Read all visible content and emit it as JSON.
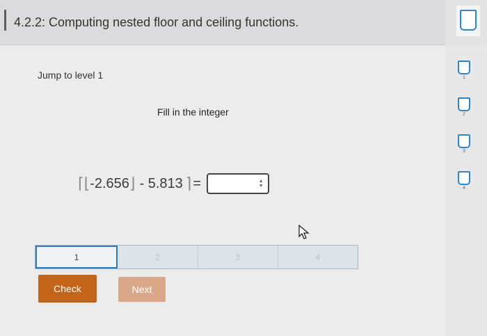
{
  "header": {
    "title": "4.2.2: Computing nested floor and ceiling functions."
  },
  "main": {
    "jump_label": "Jump to level 1",
    "instruction": "Fill in the integer",
    "equation": {
      "ceil_open": "⌈",
      "floor_open": "⌊",
      "value_a": "-2.656",
      "floor_close": "⌋",
      "operator_text": "- 5.813",
      "ceil_close": "⌉",
      "equals": "=",
      "answer_value": ""
    }
  },
  "levels": [
    {
      "label": "1",
      "active": true
    },
    {
      "label": "2",
      "active": false
    },
    {
      "label": "3",
      "active": false
    },
    {
      "label": "4",
      "active": false
    }
  ],
  "buttons": {
    "check": "Check",
    "next": "Next"
  },
  "side_levels": [
    "1",
    "2",
    "3",
    "4"
  ],
  "colors": {
    "accent_blue": "#2f86c4",
    "check_orange": "#c2651a",
    "next_disabled": "#d9a88a"
  }
}
